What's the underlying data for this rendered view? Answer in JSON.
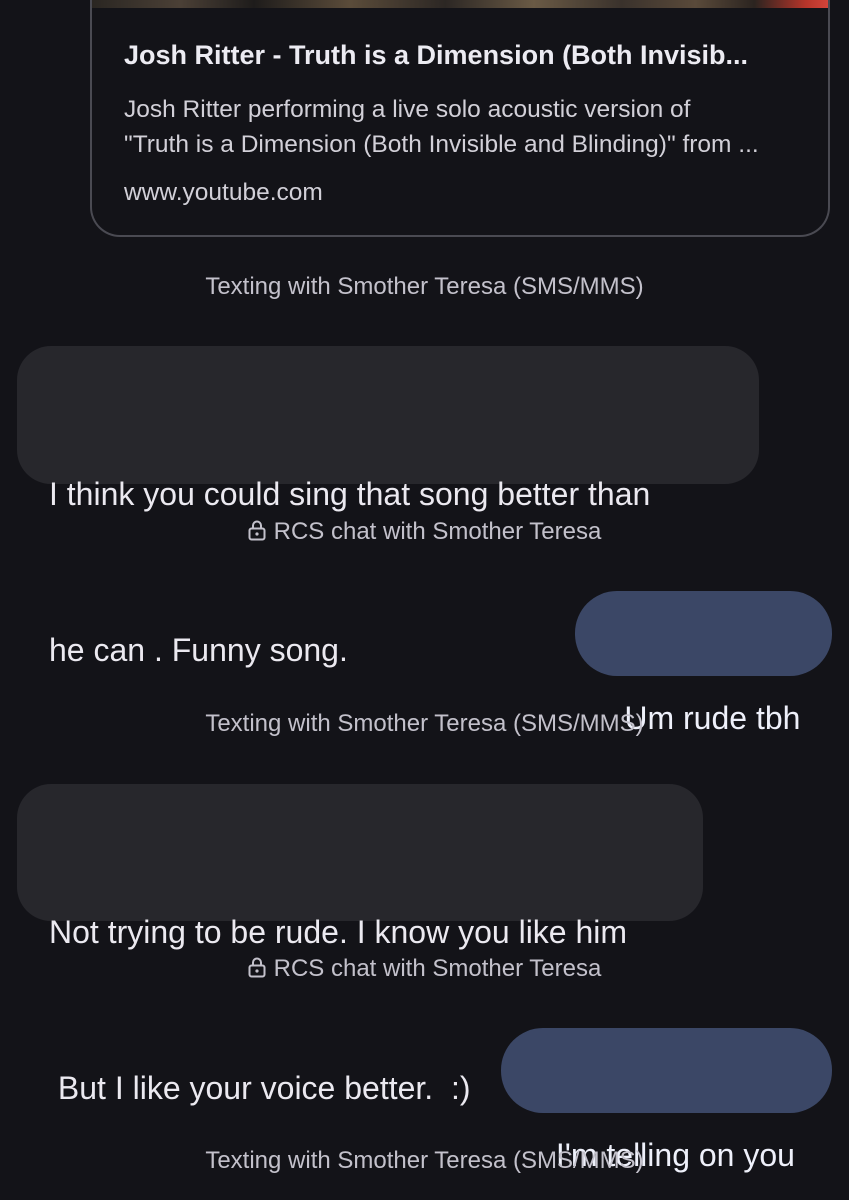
{
  "link_preview": {
    "title": "Josh Ritter - Truth is a Dimension (Both Invisib...",
    "description_line1": "Josh Ritter performing a live solo acoustic version of",
    "description_line2": "\"Truth is a Dimension (Both Invisible and Blinding)\" from ...",
    "domain": "www.youtube.com"
  },
  "conversation": {
    "sms_status": "Texting with Smother Teresa (SMS/MMS)",
    "rcs_status": "RCS chat with Smother Teresa",
    "messages": [
      {
        "direction": "incoming",
        "line1": "I think you could sing that song better than",
        "line2": "he can . Funny song."
      },
      {
        "direction": "outgoing",
        "text": "Um rude tbh"
      },
      {
        "direction": "incoming",
        "line1": "Not trying to be rude. I know you like him",
        "line2": " But I like your voice better.  :)"
      },
      {
        "direction": "outgoing",
        "text": "I'm telling on you"
      }
    ]
  },
  "colors": {
    "background": "#131318",
    "incoming_bubble": "#27272c",
    "outgoing_bubble": "#3b4766",
    "card_border": "#4a4a52"
  },
  "icons": {
    "lock": "lock-icon"
  }
}
